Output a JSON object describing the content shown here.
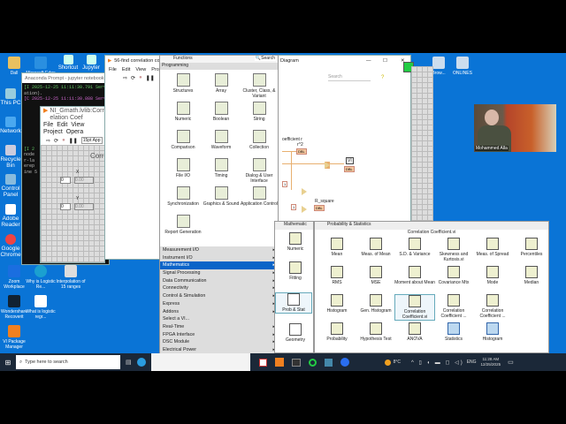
{
  "desktop": {
    "icons": [
      {
        "label": "Dall"
      },
      {
        "label": "Microsoft Edge"
      },
      {
        "label": "Shortcut"
      },
      {
        "label": "Jupyter"
      },
      {
        "label": "This PC"
      },
      {
        "label": "Network"
      },
      {
        "label": "Recycle Bin"
      },
      {
        "label": "Control Panel"
      },
      {
        "label": "Adobe Reader"
      },
      {
        "label": "Google Chrome"
      },
      {
        "label": "Zoom Workplace"
      },
      {
        "label": "Why is Logistic Re..."
      },
      {
        "label": "Interpolation of 15 ranges"
      },
      {
        "label": "Wondershare Recoverit"
      },
      {
        "label": "What is logistic regr..."
      },
      {
        "label": "VI Package Manager"
      },
      {
        "label": "Brow..."
      },
      {
        "label": "ONLINES"
      }
    ]
  },
  "anaconda": {
    "title": "Anaconda Prompt - jupyter  notebook",
    "lines": [
      "[I 2025-12-25 11:11:30.791 Serv",
      "ation).",
      "[C 2025-12-25 11:11:30.888 Serv",
      "[I 2",
      "node",
      "r-la",
      "erep",
      "ine 5"
    ]
  },
  "front_panel": {
    "title": "NI_Gmath.lvlib:Correlation Coef",
    "menu": [
      "File",
      "Edit",
      "View",
      "Project",
      "Opera"
    ],
    "font": "15pt App",
    "heading": "Corr",
    "x_label": "X",
    "y_label": "Y",
    "x_value": "0",
    "y_value": "0",
    "x_out": "0.00",
    "y_out": "0.00"
  },
  "block_diagram": {
    "title": "56-find correlation coe",
    "title_right": "Diagram",
    "menu": [
      "File",
      "Edit",
      "View",
      "Project"
    ],
    "search_placeholder": "Search",
    "labels": {
      "coef": "oefficient r",
      "r2": "r^2",
      "vi": "VI",
      "rsq": "R_square",
      "one_a": "1",
      "one_b": "1"
    },
    "ind": "DBL"
  },
  "functions": {
    "title": "Functions",
    "search": "Search",
    "category": "Programming",
    "items": [
      "Structures",
      "Array",
      "Cluster, Class, & Variant",
      "Numeric",
      "Boolean",
      "String",
      "Comparison",
      "Waveform",
      "Collection",
      "File I/O",
      "Timing",
      "Dialog & User Interface",
      "Synchronization",
      "Graphics & Sound",
      "Application Control",
      "Report Generation"
    ],
    "menu": [
      "Measurement I/O",
      "Instrument I/O",
      "Mathematics",
      "Signal Processing",
      "Data Communication",
      "Connectivity",
      "Control & Simulation",
      "Express",
      "Addons",
      "Select a VI...",
      "Real-Time",
      "FPGA Interface",
      "DSC Module",
      "Electrical Power"
    ],
    "selected": "Mathematics"
  },
  "mathematics": {
    "title": "Mathematic",
    "items": [
      "Numeric",
      "Fitting",
      "Prob & Stat",
      "Geometry"
    ]
  },
  "prob_stats": {
    "title": "Probability & Statistics",
    "tooltip": "Correlation Coefficient.vi",
    "items": [
      "Mean",
      "Meas. of Mean",
      "S.D. & Variance",
      "Skewness and Kurtosis.vi",
      "Meas. of Spread",
      "Percentiles",
      "RMS",
      "MSE",
      "Moment about Mean",
      "Covariance Mtx",
      "Mode",
      "Median",
      "Histogram",
      "Gen. Histogram",
      "Correlation Coefficient.vi",
      "Correlation Coefficient ...",
      "Correlation Coefficient ...",
      "",
      "Probability",
      "Hypothesis Test",
      "ANOVA",
      "Statistics",
      "Histogram"
    ]
  },
  "webcam": {
    "name": "Mohammed Alla"
  },
  "taskbar": {
    "search_placeholder": "Type here to search",
    "weather": "8°C",
    "lang": "ENG",
    "time": "11:28 AM",
    "date": "12/25/2025"
  }
}
